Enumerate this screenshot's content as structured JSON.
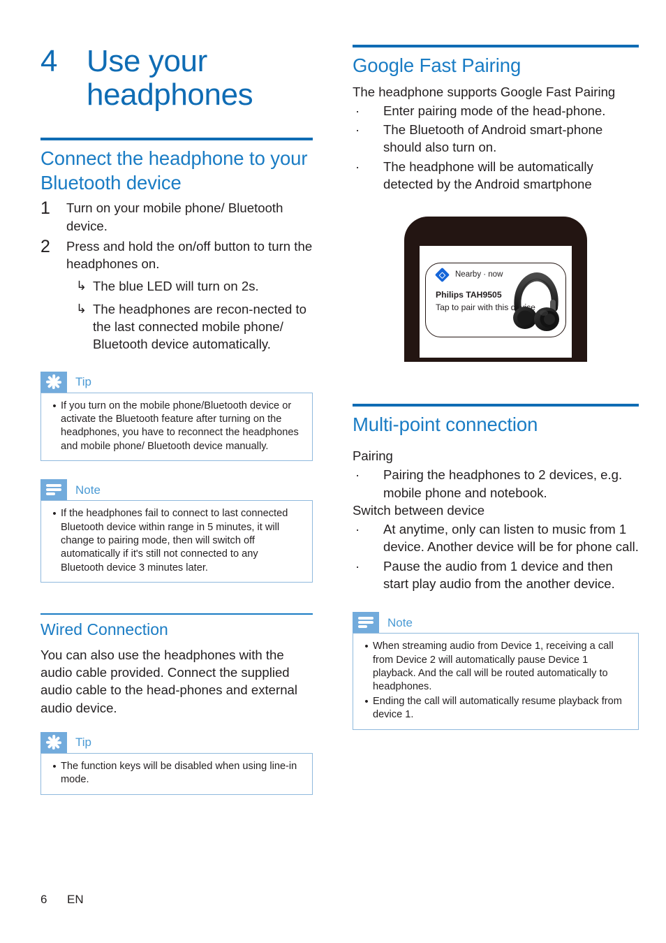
{
  "chapter": {
    "number": "4",
    "title": "Use your headphones"
  },
  "left": {
    "section1": {
      "heading": "Connect the headphone to your Bluetooth device",
      "steps": [
        {
          "num": "1",
          "text": "Turn on your mobile phone/ Bluetooth device.",
          "substeps": []
        },
        {
          "num": "2",
          "text": "Press and hold the on/off button to turn the headphones on.",
          "substeps": [
            "The blue LED will turn on 2s.",
            "The headphones are recon-nected to the last connected mobile phone/ Bluetooth device automatically."
          ]
        }
      ],
      "arrow_glyph": "↳"
    },
    "tip1": {
      "label": "Tip",
      "icon": "asterisk-icon",
      "items": [
        "If you turn on the mobile phone/Bluetooth device or activate the Bluetooth feature after turning on the headphones, you have to reconnect the headphones and mobile phone/ Bluetooth device manually."
      ]
    },
    "note1": {
      "label": "Note",
      "icon": "lines-icon",
      "items": [
        "If the headphones fail to connect to last connected Bluetooth device within range in 5 minutes, it will change to pairing mode, then will switch off automatically if it's still not connected to any Bluetooth device 3 minutes later."
      ]
    },
    "section2": {
      "heading": "Wired Connection",
      "paragraph": "You can also use the headphones with the audio cable provided. Connect the supplied audio cable to the head-phones and external audio device."
    },
    "tip2": {
      "label": "Tip",
      "icon": "asterisk-icon",
      "items": [
        "The function keys will be disabled when using line-in mode."
      ]
    }
  },
  "right": {
    "section1": {
      "heading": "Google Fast Pairing",
      "intro": "The headphone supports Google Fast Pairing",
      "bullet_glyph": "·",
      "bullets": [
        "Enter pairing mode of the head-phone.",
        "The Bluetooth of Android smart-phone should also turn on.",
        "The headphone will be automatically detected by the Android smartphone"
      ]
    },
    "phone": {
      "notification": {
        "source_icon": "nearby-diamond-icon",
        "source": "Nearby · now",
        "title": "Philips TAH9505",
        "subtitle": "Tap to pair with this device",
        "product_image": "headphones-image"
      }
    },
    "section2": {
      "heading": "Multi-point connection",
      "bullet_glyph": "·",
      "groups": [
        {
          "label": "Pairing",
          "bullets": [
            "Pairing the headphones to 2 devices, e.g. mobile phone and notebook."
          ]
        },
        {
          "label": "Switch between device",
          "bullets": [
            "At anytime, only can listen to music from 1 device. Another device will be for phone call.",
            "Pause the audio from 1 device and then start play audio from the another device."
          ]
        }
      ]
    },
    "note2": {
      "label": "Note",
      "icon": "lines-icon",
      "items": [
        "When streaming audio from Device 1, receiving a call from Device 2 will automatically pause Device 1 playback. And the call will be routed automatically to headphones.",
        "Ending the call will automatically resume playback from device 1."
      ]
    }
  },
  "footer": {
    "page_number": "6",
    "language": "EN"
  },
  "colors": {
    "heading_blue": "#1a7cc4",
    "chapter_blue": "#0f6cb4",
    "badge_blue": "#72abdc",
    "box_border": "#8fb9dd",
    "nearby_blue": "#1565d8",
    "text": "#231f20"
  }
}
